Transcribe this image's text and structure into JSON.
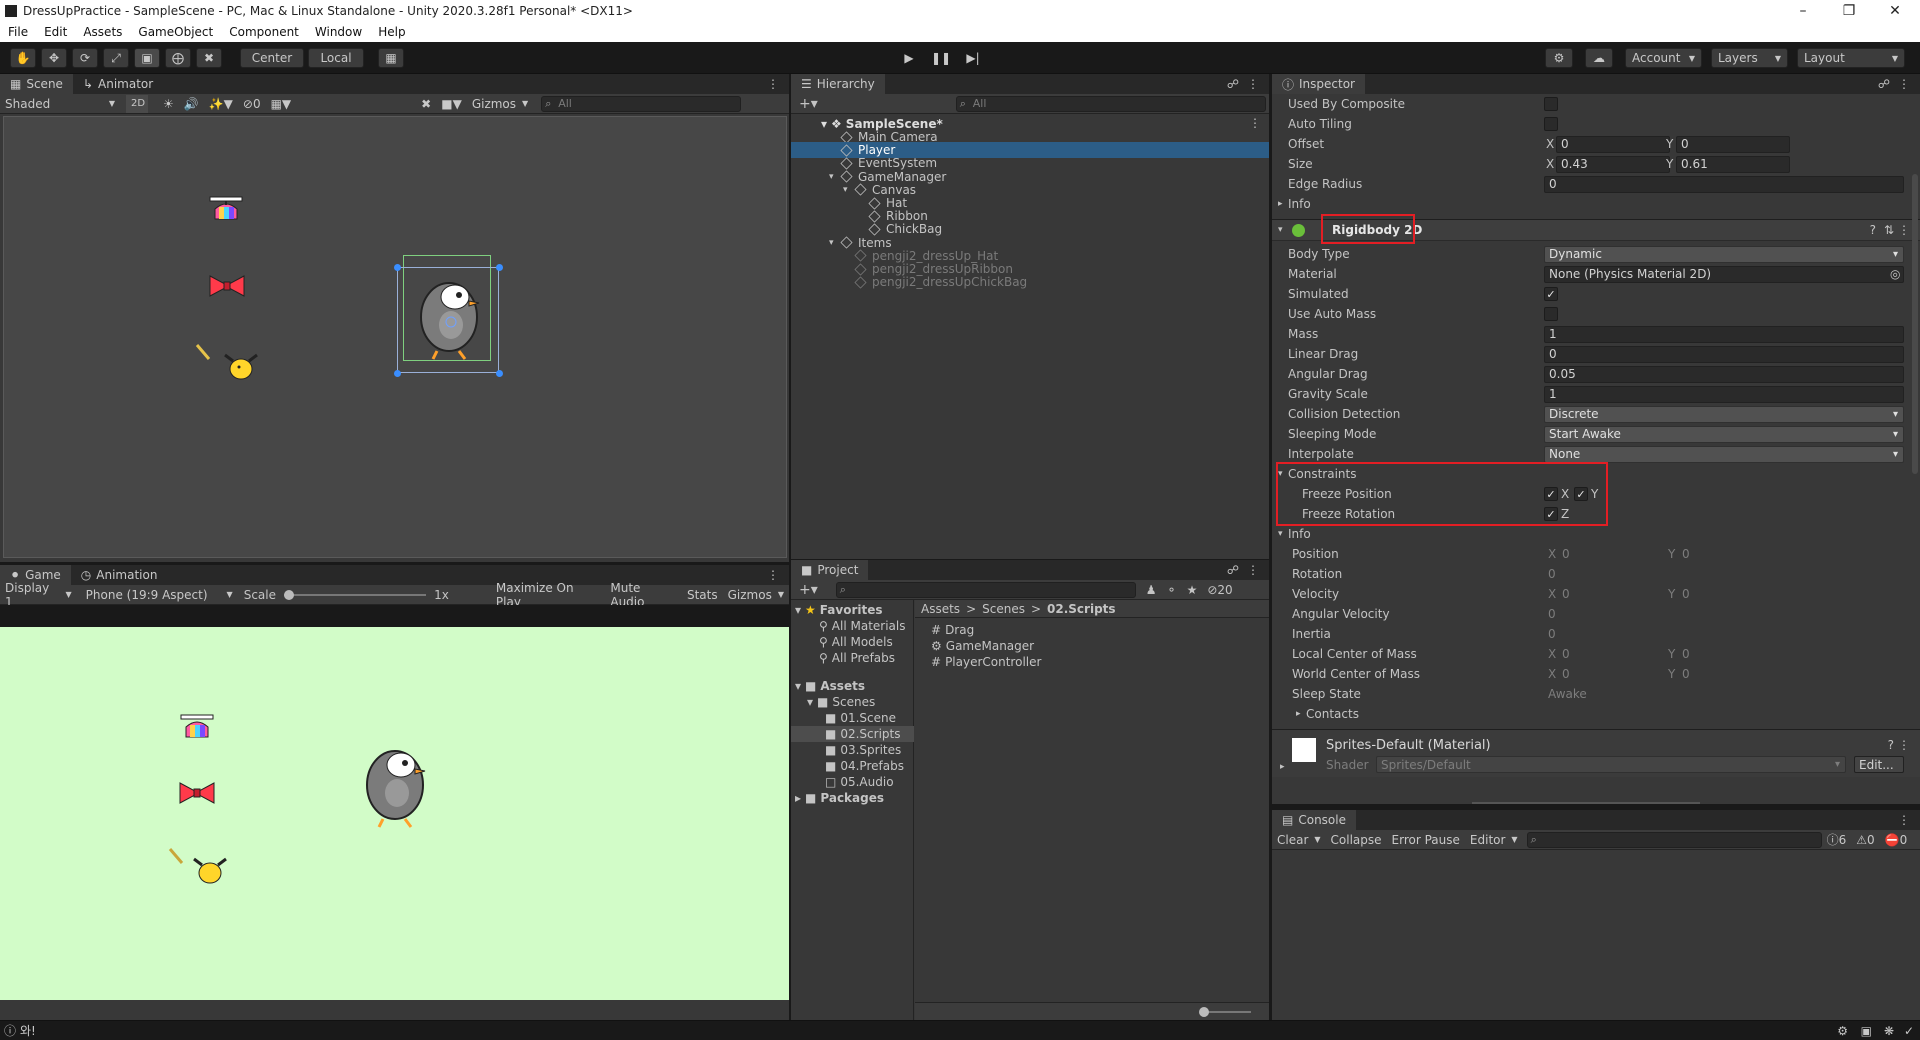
{
  "window": {
    "title": "DressUpPractice - SampleScene - PC, Mac & Linux Standalone - Unity 2020.3.28f1 Personal* <DX11>"
  },
  "menu": [
    "File",
    "Edit",
    "Assets",
    "GameObject",
    "Component",
    "Window",
    "Help"
  ],
  "toolbar": {
    "center": "Center",
    "local": "Local",
    "account": "Account",
    "layers": "Layers",
    "layout": "Layout"
  },
  "scene": {
    "tabs": [
      "Scene",
      "Animator"
    ],
    "shading": "Shaded",
    "mode2d": "2D",
    "hidden_count": "0",
    "gizmos": "Gizmos",
    "search_placeholder": "All",
    "background": "#474747"
  },
  "game": {
    "tabs": [
      "Game",
      "Animation"
    ],
    "display": "Display 1",
    "aspect": "Phone (19:9 Aspect)",
    "scale_label": "Scale",
    "scale_value": "1x",
    "maximize": "Maximize On Play",
    "mute": "Mute Audio",
    "stats": "Stats",
    "gizmos": "Gizmos",
    "background": "#d2fcc8"
  },
  "hierarchy": {
    "tab": "Hierarchy",
    "search_placeholder": "All",
    "scene": "SampleScene*",
    "items": [
      {
        "name": "Main Camera",
        "depth": 1,
        "selected": false,
        "inactive": false
      },
      {
        "name": "Player",
        "depth": 1,
        "selected": true,
        "inactive": false
      },
      {
        "name": "EventSystem",
        "depth": 1,
        "selected": false,
        "inactive": false
      },
      {
        "name": "GameManager",
        "depth": 1,
        "selected": false,
        "inactive": false
      },
      {
        "name": "Canvas",
        "depth": 2,
        "selected": false,
        "inactive": false
      },
      {
        "name": "Hat",
        "depth": 3,
        "selected": false,
        "inactive": false
      },
      {
        "name": "Ribbon",
        "depth": 3,
        "selected": false,
        "inactive": false
      },
      {
        "name": "ChickBag",
        "depth": 3,
        "selected": false,
        "inactive": false
      },
      {
        "name": "Items",
        "depth": 1,
        "selected": false,
        "inactive": false
      },
      {
        "name": "pengji2_dressUp_Hat",
        "depth": 2,
        "selected": false,
        "inactive": true
      },
      {
        "name": "pengji2_dressUpRibbon",
        "depth": 2,
        "selected": false,
        "inactive": true
      },
      {
        "name": "pengji2_dressUpChickBag",
        "depth": 2,
        "selected": false,
        "inactive": true
      }
    ]
  },
  "project": {
    "tab": "Project",
    "hidden_count": "20",
    "favorites": {
      "label": "Favorites",
      "items": [
        "All Materials",
        "All Models",
        "All Prefabs"
      ]
    },
    "assets": {
      "label": "Assets",
      "scenes": "Scenes",
      "folders": [
        "01.Scene",
        "02.Scripts",
        "03.Sprites",
        "04.Prefabs",
        "05.Audio"
      ]
    },
    "packages": "Packages",
    "breadcrumb": [
      "Assets",
      "Scenes",
      "02.Scripts"
    ],
    "files": [
      "Drag",
      "GameManager",
      "PlayerController"
    ]
  },
  "inspector": {
    "tab": "Inspector",
    "collider_rows": {
      "used_by_composite": "Used By Composite",
      "auto_tiling": "Auto Tiling",
      "offset": "Offset",
      "offset_x": "0",
      "offset_y": "0",
      "size": "Size",
      "size_x": "0.43",
      "size_y": "0.61",
      "edge_radius": "Edge Radius",
      "edge_radius_val": "0",
      "info": "Info"
    },
    "rigidbody": {
      "title": "Rigidbody 2D",
      "body_type": "Body Type",
      "body_type_val": "Dynamic",
      "material": "Material",
      "material_val": "None (Physics Material 2D)",
      "simulated": "Simulated",
      "use_auto_mass": "Use Auto Mass",
      "mass": "Mass",
      "mass_val": "1",
      "linear_drag": "Linear Drag",
      "linear_drag_val": "0",
      "angular_drag": "Angular Drag",
      "angular_drag_val": "0.05",
      "gravity_scale": "Gravity Scale",
      "gravity_scale_val": "1",
      "collision_detection": "Collision Detection",
      "collision_detection_val": "Discrete",
      "sleeping_mode": "Sleeping Mode",
      "sleeping_mode_val": "Start Awake",
      "interpolate": "Interpolate",
      "interpolate_val": "None",
      "constraints": "Constraints",
      "freeze_position": "Freeze Position",
      "freeze_rotation": "Freeze Rotation",
      "info": "Info",
      "position": "Position",
      "rotation": "Rotation",
      "velocity": "Velocity",
      "angular_velocity": "Angular Velocity",
      "inertia": "Inertia",
      "local_com": "Local Center of Mass",
      "world_com": "World Center of Mass",
      "sleep_state": "Sleep State",
      "sleep_state_val": "Awake",
      "contacts": "Contacts",
      "zero": "0"
    },
    "material": {
      "title": "Sprites-Default (Material)",
      "shader": "Shader",
      "shader_val": "Sprites/Default",
      "edit": "Edit..."
    }
  },
  "console": {
    "tab": "Console",
    "clear": "Clear",
    "collapse": "Collapse",
    "error_pause": "Error Pause",
    "editor": "Editor",
    "info_count": "6",
    "warn_count": "0",
    "error_count": "0"
  },
  "status": {
    "message": "와!"
  }
}
